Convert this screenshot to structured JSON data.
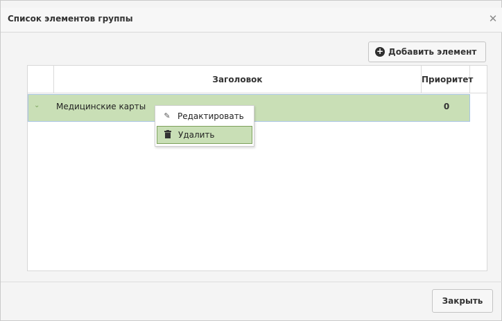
{
  "dialog": {
    "title": "Список элементов группы",
    "close_icon": "close-icon"
  },
  "toolbar": {
    "add_label": "Добавить элемент",
    "add_icon": "plus-circle-icon"
  },
  "grid": {
    "columns": [
      "",
      "Заголовок",
      "Приоритет"
    ],
    "rows": [
      {
        "name": "Медицинские карты",
        "priority": "0",
        "selected": true
      }
    ]
  },
  "context_menu": {
    "items": [
      {
        "label": "Редактировать",
        "icon": "pencil-icon"
      },
      {
        "label": "Удалить",
        "icon": "trash-icon"
      }
    ]
  },
  "footer": {
    "close_label": "Закрыть"
  },
  "colors": {
    "selected_row": "#c9dfb6",
    "dialog_bg": "#f4f4f4"
  }
}
